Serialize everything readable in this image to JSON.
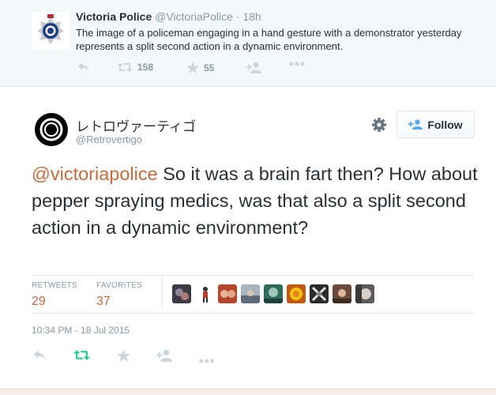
{
  "parent_tweet": {
    "name": "Victoria Police",
    "handle": "@VictoriaPolice",
    "dot": "·",
    "time": "18h",
    "text": "The image of a policeman engaging in a hand gesture with a demonstrator yesterday represents a split second action in a dynamic environment.",
    "retweet_count": "158",
    "favorite_count": "55",
    "icons": [
      "reply-icon",
      "retweet-icon",
      "favorite-icon",
      "follow-icon",
      "more-icon"
    ]
  },
  "tweet": {
    "display_name": "レトロヴァーティゴ",
    "screen_name": "@Retrovertigo",
    "follow_label": "Follow",
    "mention": "@victoriapolice",
    "text": " So it was a brain fart then? How about pepper spraying medics, was that also a split second action in a dynamic environment?",
    "retweets_label": "RETWEETS",
    "retweets_value": "29",
    "favorites_label": "FAVORITES",
    "favorites_value": "37",
    "timestamp": "10:34 PM - 18 Jul 2015",
    "icons": [
      "gear-icon",
      "follow-person-icon",
      "reply-icon",
      "retweet-icon",
      "favorite-icon",
      "follow-icon",
      "more-icon"
    ]
  },
  "colors": {
    "mention": "#c56b3d",
    "stat_value": "#c56b3d",
    "retweet_active": "#19cf86",
    "muted": "#8899a6",
    "icon": "#ccd6dd",
    "parent_bg": "#f5f8fa"
  },
  "favoriters_count_shown": 9
}
